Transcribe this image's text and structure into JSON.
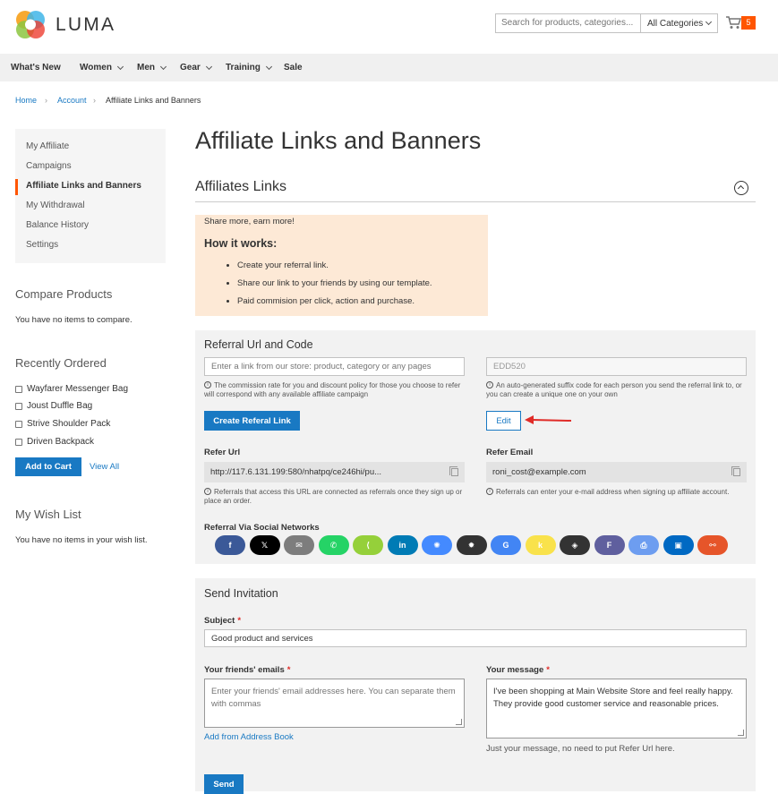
{
  "header": {
    "logo_text": "LUMA",
    "search_placeholder": "Search for products, categories...",
    "category_select": "All Categories",
    "cart_count": "5"
  },
  "nav": [
    {
      "label": "What's New",
      "has_menu": false
    },
    {
      "label": "Women",
      "has_menu": true
    },
    {
      "label": "Men",
      "has_menu": true
    },
    {
      "label": "Gear",
      "has_menu": true
    },
    {
      "label": "Training",
      "has_menu": true
    },
    {
      "label": "Sale",
      "has_menu": false
    }
  ],
  "breadcrumb": {
    "home": "Home",
    "account": "Account",
    "current": "Affiliate Links and Banners"
  },
  "sidebar": {
    "items": [
      "My Affiliate",
      "Campaigns",
      "Affiliate Links and Banners",
      "My Withdrawal",
      "Balance History",
      "Settings"
    ],
    "active_index": 2,
    "compare_title": "Compare Products",
    "compare_text": "You have no items to compare.",
    "recent_title": "Recently Ordered",
    "recent_items": [
      "Wayfarer Messenger Bag",
      "Joust Duffle Bag",
      "Strive Shoulder Pack",
      "Driven Backpack"
    ],
    "add_to_cart": "Add to Cart",
    "view_all": "View All",
    "wishlist_title": "My Wish List",
    "wishlist_text": "You have no items in your wish list."
  },
  "main": {
    "page_title": "Affiliate Links and Banners",
    "section_title": "Affiliates Links",
    "info": {
      "tagline": "Share more, earn more!",
      "how_title": "How it works:",
      "steps": [
        "Create your referral link.",
        "Share our link to your friends by using our template.",
        "Paid commision per click, action and purchase."
      ]
    },
    "referral": {
      "title": "Referral Url and Code",
      "link_placeholder": "Enter a link from our store: product, category or any pages",
      "code_value": "EDD520",
      "link_note": "The commission rate for you and discount policy for those you choose to refer will correspond with any available affiliate campaign",
      "code_note": "An auto-generated suffix code for each person you send the referral link to, or you can create a unique one on your own",
      "create_button": "Create Referal Link",
      "edit_button": "Edit",
      "refer_url_label": "Refer Url",
      "refer_url_value": "http://117.6.131.199:580/nhatpq/ce246hi/pu...",
      "refer_url_note": "Referrals that access this URL are connected as referrals once they sign up or place an order.",
      "refer_email_label": "Refer Email",
      "refer_email_value": "roni_cost@example.com",
      "refer_email_note": "Referrals can enter your e-mail address when signing up affiliate account.",
      "social_label": "Referral Via Social Networks"
    },
    "social": [
      {
        "name": "facebook-icon",
        "glyph": "f",
        "color": "#3b5998"
      },
      {
        "name": "x-icon",
        "glyph": "𝕏",
        "color": "#000000"
      },
      {
        "name": "email-icon",
        "glyph": "✉",
        "color": "#7d7d7d"
      },
      {
        "name": "whatsapp-icon",
        "glyph": "✆",
        "color": "#25d366"
      },
      {
        "name": "share-icon",
        "glyph": "⟨",
        "color": "#95d03a"
      },
      {
        "name": "linkedin-icon",
        "glyph": "in",
        "color": "#007bb5"
      },
      {
        "name": "messenger-icon",
        "glyph": "✺",
        "color": "#448aff"
      },
      {
        "name": "bug-icon",
        "glyph": "✹",
        "color": "#333333"
      },
      {
        "name": "google-icon",
        "glyph": "G",
        "color": "#4285f4"
      },
      {
        "name": "k-icon",
        "glyph": "k",
        "color": "#f9e24b"
      },
      {
        "name": "layers-icon",
        "glyph": "◈",
        "color": "#333333"
      },
      {
        "name": "f-icon",
        "glyph": "F",
        "color": "#5f5f9e"
      },
      {
        "name": "print-icon",
        "glyph": "⎙",
        "color": "#6d9df0"
      },
      {
        "name": "trello-icon",
        "glyph": "▣",
        "color": "#0069c3"
      },
      {
        "name": "link-icon",
        "glyph": "⚯",
        "color": "#e6552a"
      }
    ],
    "invite": {
      "title": "Send Invitation",
      "subject_label": "Subject",
      "subject_value": "Good product and services",
      "emails_label": "Your friends' emails",
      "emails_placeholder": "Enter your friends' email addresses here. You can separate them with commas",
      "address_book": "Add from Address Book",
      "message_label": "Your message",
      "message_value": "I've been shopping at Main Website Store and feel really happy. They provide good customer service and reasonable prices.",
      "message_note": "Just your message, no need to put Refer Url here.",
      "send_button": "Send"
    }
  }
}
